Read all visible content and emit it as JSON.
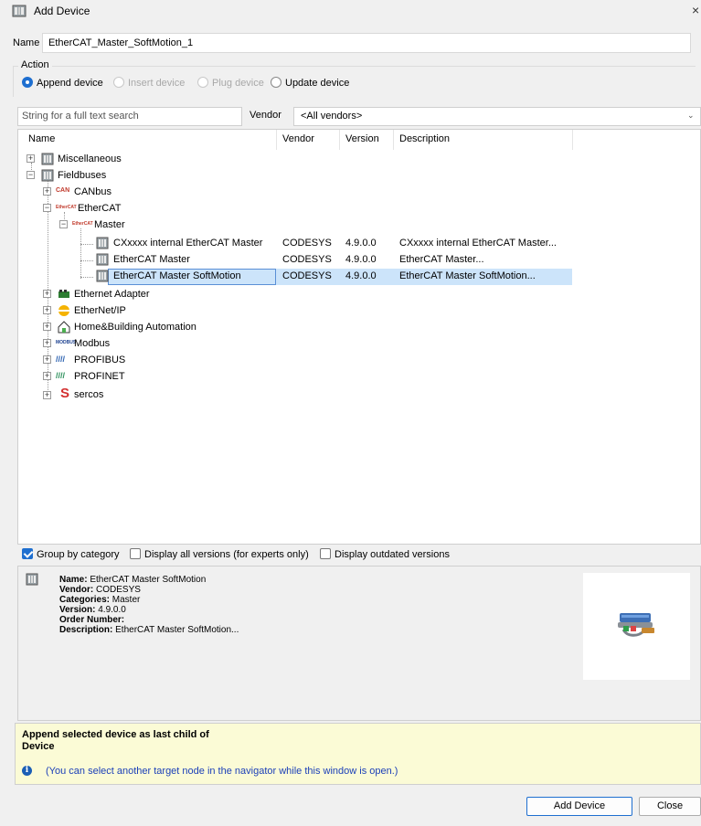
{
  "window": {
    "title": "Add Device",
    "close_glyph": "×"
  },
  "name_row": {
    "label": "Name",
    "value": "EtherCAT_Master_SoftMotion_1"
  },
  "action": {
    "group_label": "Action",
    "options": [
      {
        "label": "Append device",
        "selected": true,
        "enabled": true
      },
      {
        "label": "Insert device",
        "selected": false,
        "enabled": false
      },
      {
        "label": "Plug device",
        "selected": false,
        "enabled": false
      },
      {
        "label": "Update device",
        "selected": false,
        "enabled": true
      }
    ]
  },
  "search": {
    "placeholder": "String for a full text search",
    "vendor_label": "Vendor",
    "vendor_value": "<All vendors>"
  },
  "tree": {
    "columns": [
      "Name",
      "Vendor",
      "Version",
      "Description"
    ],
    "rows": [
      {
        "name": "Miscellaneous",
        "icon": "device-icon"
      },
      {
        "name": "Fieldbuses",
        "icon": "device-icon"
      },
      {
        "name": "CANbus",
        "icon": "canbus-icon"
      },
      {
        "name": "EtherCAT",
        "icon": "ethercat-icon"
      },
      {
        "name": "Master",
        "icon": "ethercat-icon"
      },
      {
        "name": "CXxxxx internal EtherCAT Master",
        "icon": "device-icon",
        "vendor": "CODESYS",
        "version": "4.9.0.0",
        "description": "CXxxxx internal EtherCAT Master..."
      },
      {
        "name": "EtherCAT Master",
        "icon": "device-icon",
        "vendor": "CODESYS",
        "version": "4.9.0.0",
        "description": "EtherCAT Master..."
      },
      {
        "name": "EtherCAT Master SoftMotion",
        "icon": "device-icon",
        "vendor": "CODESYS",
        "version": "4.9.0.0",
        "description": "EtherCAT Master SoftMotion...",
        "selected": true
      },
      {
        "name": "Ethernet Adapter",
        "icon": "ethernet-adapter-icon"
      },
      {
        "name": "EtherNet/IP",
        "icon": "ethernetip-icon"
      },
      {
        "name": "Home&Building Automation",
        "icon": "home-icon"
      },
      {
        "name": "Modbus",
        "icon": "modbus-icon"
      },
      {
        "name": "PROFIBUS",
        "icon": "profibus-icon"
      },
      {
        "name": "PROFINET",
        "icon": "profinet-icon"
      },
      {
        "name": "sercos",
        "icon": "sercos-icon"
      }
    ],
    "icon_texts": {
      "canbus": "CAN",
      "ethercat": "EtherCAT",
      "modbus": "MODBUS",
      "profibus": "////",
      "sercos": "S"
    }
  },
  "options": {
    "group_by_category": {
      "label": "Group by category",
      "checked": true
    },
    "display_all_versions": {
      "label": "Display all versions (for experts only)",
      "checked": false
    },
    "display_outdated": {
      "label": "Display outdated versions",
      "checked": false
    }
  },
  "info": {
    "name_label": "Name:",
    "name_value": " EtherCAT Master SoftMotion",
    "vendor_label": "Vendor:",
    "vendor_value": " CODESYS",
    "categories_label": "Categories:",
    "categories_value": " Master",
    "version_label": "Version:",
    "version_value": " 4.9.0.0",
    "order_label": "Order Number:",
    "order_value": "",
    "description_label": "Description:",
    "description_value": " EtherCAT Master SoftMotion..."
  },
  "append": {
    "title": "Append selected device as last child of",
    "target": "Device",
    "hint": "(You can select another target node in the navigator while this window is open.)",
    "info_glyph": "i"
  },
  "buttons": {
    "add": "Add Device",
    "close": "Close"
  },
  "colors": {
    "accent": "#1e6fd0",
    "selection": "#cce4fa",
    "hint_text": "#1b3fb8",
    "append_bg": "#fbfbd6"
  }
}
